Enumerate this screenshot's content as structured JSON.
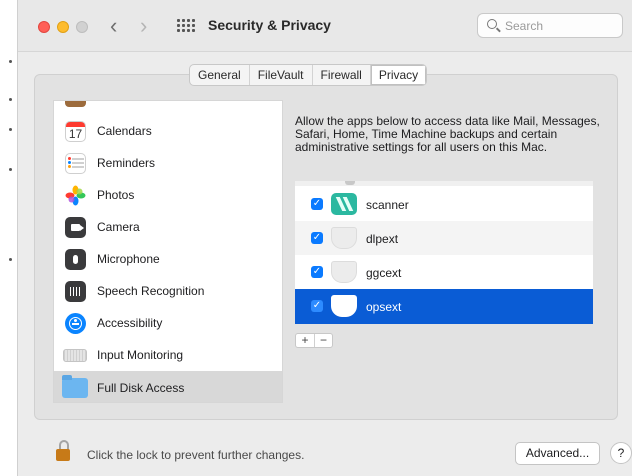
{
  "window": {
    "title": "Security & Privacy",
    "search_placeholder": "Search"
  },
  "tabs": [
    {
      "label": "General"
    },
    {
      "label": "FileVault"
    },
    {
      "label": "Firewall"
    },
    {
      "label": "Privacy",
      "active": true
    }
  ],
  "sidebar": {
    "items": [
      {
        "label": "Calendars",
        "icon": "calendar-icon",
        "icon_text": "17"
      },
      {
        "label": "Reminders",
        "icon": "reminders-icon"
      },
      {
        "label": "Photos",
        "icon": "photos-icon"
      },
      {
        "label": "Camera",
        "icon": "camera-icon"
      },
      {
        "label": "Microphone",
        "icon": "microphone-icon"
      },
      {
        "label": "Speech Recognition",
        "icon": "speech-recognition-icon"
      },
      {
        "label": "Accessibility",
        "icon": "accessibility-icon"
      },
      {
        "label": "Input Monitoring",
        "icon": "keyboard-icon"
      },
      {
        "label": "Full Disk Access",
        "icon": "folder-icon",
        "selected": true
      }
    ]
  },
  "main": {
    "description": "Allow the apps below to access data like Mail, Messages, Safari, Home, Time Machine backups and certain administrative settings for all users on this Mac.",
    "apps": [
      {
        "name": "scanner",
        "checked": true,
        "icon": "scanner-app-icon"
      },
      {
        "name": "dlpext",
        "checked": true,
        "icon": "shield-icon"
      },
      {
        "name": "ggcext",
        "checked": true,
        "icon": "shield-icon"
      },
      {
        "name": "opsext",
        "checked": true,
        "icon": "shield-icon",
        "selected": true
      }
    ],
    "add_label": "+",
    "remove_label": "−",
    "checkmark": "✓"
  },
  "footer": {
    "lock_text": "Click the lock to prevent further changes.",
    "advanced_label": "Advanced...",
    "help_label": "?"
  },
  "nav": {
    "back": "‹",
    "forward": "›"
  },
  "colors": {
    "accent": "#0a5cd5",
    "checkbox": "#0a7aff",
    "close": "#ff5f57",
    "minimize": "#febc2e"
  }
}
